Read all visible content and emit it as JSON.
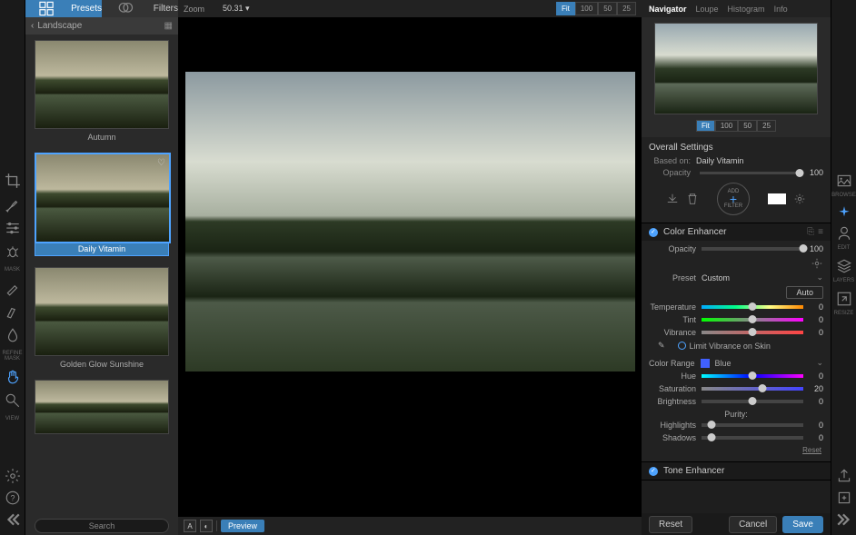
{
  "left_rail": {
    "mask_label": "MASK",
    "refine_label": "REFINE\nMASK",
    "view_label": "VIEW"
  },
  "sidebar": {
    "tabs": {
      "presets": "Presets",
      "filters": "Filters"
    },
    "breadcrumb": "Landscape",
    "presets": [
      {
        "name": "Autumn"
      },
      {
        "name": "Daily Vitamin"
      },
      {
        "name": "Golden Glow Sunshine"
      },
      {
        "name": ""
      }
    ],
    "search_placeholder": "Search"
  },
  "canvas": {
    "zoom_label": "Zoom",
    "zoom_value": "50.31",
    "zoom_buttons": [
      "Fit",
      "100",
      "50",
      "25"
    ],
    "preview_label": "Preview",
    "a_label": "A"
  },
  "nav": {
    "tabs": [
      "Navigator",
      "Loupe",
      "Histogram",
      "Info"
    ],
    "zoom_buttons": [
      "Fit",
      "100",
      "50",
      "25"
    ]
  },
  "overall": {
    "title": "Overall Settings",
    "based_on_label": "Based on:",
    "based_on_value": "Daily Vitamin",
    "opacity_label": "Opacity",
    "opacity_value": "100",
    "add_label": "ADD",
    "filter_label": "FILTER"
  },
  "color_enhancer": {
    "title": "Color Enhancer",
    "opacity_label": "Opacity",
    "opacity_value": "100",
    "preset_label": "Preset",
    "preset_value": "Custom",
    "auto_label": "Auto",
    "temperature_label": "Temperature",
    "temperature_value": "0",
    "tint_label": "Tint",
    "tint_value": "0",
    "vibrance_label": "Vibrance",
    "vibrance_value": "0",
    "limit_label": "Limit Vibrance on Skin",
    "color_range_label": "Color Range",
    "color_range_value": "Blue",
    "hue_label": "Hue",
    "hue_value": "0",
    "saturation_label": "Saturation",
    "saturation_value": "20",
    "brightness_label": "Brightness",
    "brightness_value": "0",
    "purity_label": "Purity:",
    "highlights_label": "Highlights",
    "highlights_value": "0",
    "shadows_label": "Shadows",
    "shadows_value": "0",
    "reset_label": "Reset"
  },
  "tone_enhancer": {
    "title": "Tone Enhancer"
  },
  "footer": {
    "reset": "Reset",
    "cancel": "Cancel",
    "save": "Save"
  },
  "right_rail": {
    "browse": "BROWSE",
    "edit": "EDIT",
    "layers": "LAYERS",
    "resize": "RESIZE"
  }
}
